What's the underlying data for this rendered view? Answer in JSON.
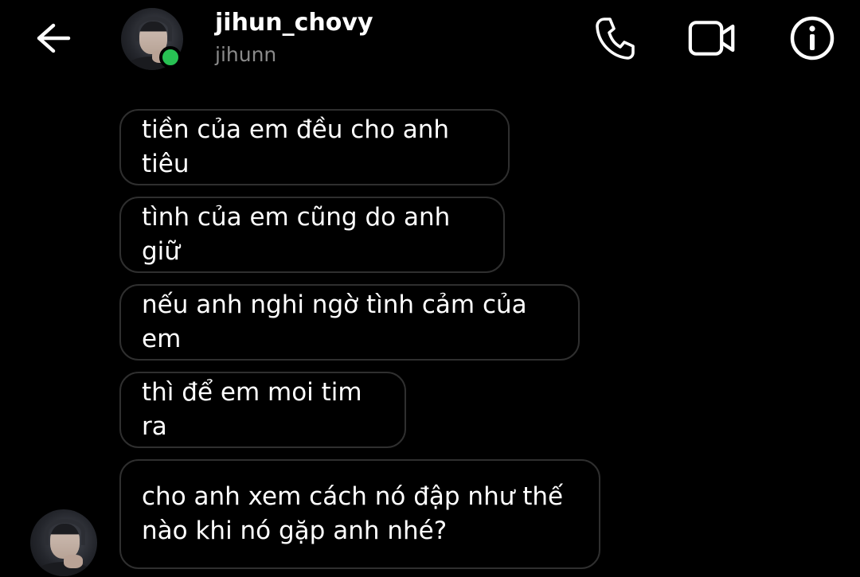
{
  "header": {
    "back_icon": "arrow-left-icon",
    "username": "jihun_chovy",
    "handle": "jihunn",
    "online_color": "#28c153",
    "actions": {
      "call_icon": "phone-icon",
      "video_icon": "video-camera-icon",
      "info_icon": "info-icon"
    }
  },
  "messages": [
    {
      "text": "tiền của em đều cho anh tiêu"
    },
    {
      "text": "tình của em cũng do anh giữ"
    },
    {
      "text": "nếu anh nghi ngờ tình cảm của em"
    },
    {
      "text": "thì để em moi tim ra"
    },
    {
      "text": "cho anh xem cách nó đập như thế\nnào khi nó gặp anh nhé?"
    }
  ],
  "theme": {
    "background": "#000000",
    "bubble_border": "#2f2f2f",
    "text": "#ffffff",
    "secondary_text": "#8a8a8a"
  }
}
